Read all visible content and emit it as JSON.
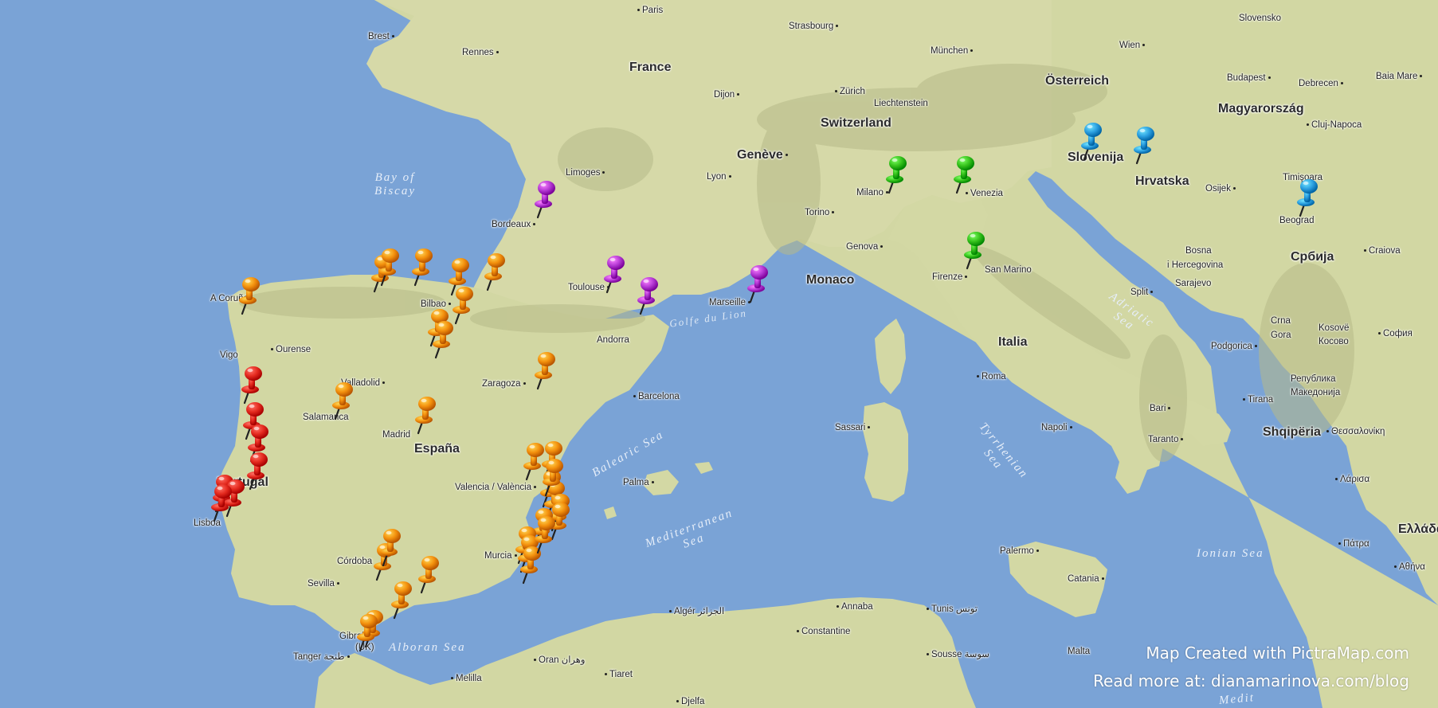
{
  "colors": {
    "sea": "#7aa3d6",
    "land": "#cfd6a3",
    "mountain": "#b4b889",
    "pin_portugal": "#e42a1f",
    "pin_spain": "#f3900d",
    "pin_france": "#b53ad4",
    "pin_italy": "#36c21c",
    "pin_balkans": "#2b9fe0"
  },
  "labels": [
    {
      "text": "Paris",
      "cls": "city dot"
    },
    {
      "text": "Brest",
      "cls": "city dotr"
    },
    {
      "text": "Rennes",
      "cls": "city dotr"
    },
    {
      "text": "France",
      "cls": "country"
    },
    {
      "text": "Strasbourg",
      "cls": "city dotr"
    },
    {
      "text": "München",
      "cls": "city dotr"
    },
    {
      "text": "Wien",
      "cls": "city dotr"
    },
    {
      "text": "Slovensko",
      "cls": "city"
    },
    {
      "text": "Budapest",
      "cls": "city dotr"
    },
    {
      "text": "Debrecen",
      "cls": "city dotr"
    },
    {
      "text": "Baia Mare",
      "cls": "city dotr"
    },
    {
      "text": "Österreich",
      "cls": "country"
    },
    {
      "text": "Magyarország",
      "cls": "country"
    },
    {
      "text": "Dijon",
      "cls": "city dotr"
    },
    {
      "text": "Zürich",
      "cls": "city dot"
    },
    {
      "text": "Liechtenstein",
      "cls": "city"
    },
    {
      "text": "Switzerland",
      "cls": "country"
    },
    {
      "text": "Cluj-Napoca",
      "cls": "city dot"
    },
    {
      "text": "Genève",
      "cls": "country dotr"
    },
    {
      "text": "Limoges",
      "cls": "city dotr"
    },
    {
      "text": "Lyon",
      "cls": "city dotr"
    },
    {
      "text": "Slovenija",
      "cls": "country"
    },
    {
      "text": "Hrvatska",
      "cls": "country"
    },
    {
      "text": "Osijek",
      "cls": "city dotr"
    },
    {
      "text": "Timişoara",
      "cls": "city"
    },
    {
      "text": "Milano",
      "cls": "city dotr"
    },
    {
      "text": "Venezia",
      "cls": "city dot"
    },
    {
      "text": "Bordeaux",
      "cls": "city dotr"
    },
    {
      "text": "Torino",
      "cls": "city dotr"
    },
    {
      "text": "Beograd",
      "cls": "city"
    },
    {
      "text": "Genova",
      "cls": "city dotr"
    },
    {
      "text": "Bosna",
      "cls": "city"
    },
    {
      "text": "i Hercegovina",
      "cls": "city"
    },
    {
      "text": "Sarajevo",
      "cls": "city"
    },
    {
      "text": "Craiova",
      "cls": "city dot"
    },
    {
      "text": "Србија",
      "cls": "country"
    },
    {
      "text": "Toulouse",
      "cls": "city dotr"
    },
    {
      "text": "Monaco",
      "cls": "country"
    },
    {
      "text": "Marseille",
      "cls": "city dotr"
    },
    {
      "text": "Firenze",
      "cls": "city dotr"
    },
    {
      "text": "San Marino",
      "cls": "city"
    },
    {
      "text": "A Coruña",
      "cls": "city"
    },
    {
      "text": "Bilbao",
      "cls": "city dotr"
    },
    {
      "text": "Split",
      "cls": "city dotr"
    },
    {
      "text": "Crna",
      "cls": "city"
    },
    {
      "text": "Gora",
      "cls": "city"
    },
    {
      "text": "Podgorica",
      "cls": "city dotr"
    },
    {
      "text": "Kosovë",
      "cls": "city"
    },
    {
      "text": "Косово",
      "cls": "city"
    },
    {
      "text": "София",
      "cls": "city dot"
    },
    {
      "text": "Ourense",
      "cls": "city dot"
    },
    {
      "text": "Andorra",
      "cls": "city"
    },
    {
      "text": "Italia",
      "cls": "country"
    },
    {
      "text": "Vigo",
      "cls": "city"
    },
    {
      "text": "Valladolid",
      "cls": "city dotr"
    },
    {
      "text": "Zaragoza",
      "cls": "city dotr"
    },
    {
      "text": "Roma",
      "cls": "city dot"
    },
    {
      "text": "Република",
      "cls": "city"
    },
    {
      "text": "Македонија",
      "cls": "city"
    },
    {
      "text": "Barcelona",
      "cls": "city dot"
    },
    {
      "text": "Tirana",
      "cls": "city dot"
    },
    {
      "text": "Salamanca",
      "cls": "city"
    },
    {
      "text": "Sassari",
      "cls": "city dotr"
    },
    {
      "text": "Bari",
      "cls": "city dotr"
    },
    {
      "text": "Madrid",
      "cls": "city"
    },
    {
      "text": "España",
      "cls": "country"
    },
    {
      "text": "Napoli",
      "cls": "city dotr"
    },
    {
      "text": "Shqipëria",
      "cls": "country"
    },
    {
      "text": "Θεσσαλονίκη",
      "cls": "city dot"
    },
    {
      "text": "Taranto",
      "cls": "city dotr"
    },
    {
      "text": "Portugal",
      "cls": "country"
    },
    {
      "text": "Valencia / València",
      "cls": "city dotr"
    },
    {
      "text": "Palma",
      "cls": "city dotr"
    },
    {
      "text": "Λάρισα",
      "cls": "city dot"
    },
    {
      "text": "Lisboa",
      "cls": "city"
    },
    {
      "text": "Ελλάδα",
      "cls": "country"
    },
    {
      "text": "Murcia",
      "cls": "city dotr"
    },
    {
      "text": "Πάτρα",
      "cls": "city dot"
    },
    {
      "text": "Córdoba",
      "cls": "city"
    },
    {
      "text": "Palermo",
      "cls": "city dotr"
    },
    {
      "text": "Αθήνα",
      "cls": "city dot"
    },
    {
      "text": "Catania",
      "cls": "city dotr"
    },
    {
      "text": "Sevilla",
      "cls": "city dotr"
    },
    {
      "text": "Algér الجزائر",
      "cls": "city dot"
    },
    {
      "text": "Annaba",
      "cls": "city dot"
    },
    {
      "text": "Tunis تونس",
      "cls": "city dot"
    },
    {
      "text": "Gibraltar",
      "cls": "city"
    },
    {
      "text": "(UK)",
      "cls": "city"
    },
    {
      "text": "Constantine",
      "cls": "city dot"
    },
    {
      "text": "Malta",
      "cls": "city"
    },
    {
      "text": "Tanger طنجة",
      "cls": "city dotr"
    },
    {
      "text": "Oran وهران",
      "cls": "city dot"
    },
    {
      "text": "Sousse سوسة",
      "cls": "city dot"
    },
    {
      "text": "Melilla",
      "cls": "city dot"
    },
    {
      "text": "Tiaret",
      "cls": "city dot"
    },
    {
      "text": "Djelfa",
      "cls": "city dot"
    }
  ],
  "seas": [
    {
      "text": "Bay of\nBiscay"
    },
    {
      "text": "Golfe du Lion"
    },
    {
      "text": "Adriatic\nSea"
    },
    {
      "text": "Balearic Sea"
    },
    {
      "text": "Tyrrhenian\nSea"
    },
    {
      "text": "Mediterranean\nSea"
    },
    {
      "text": "Ionian Sea"
    },
    {
      "text": "Alboran Sea"
    },
    {
      "text": "Medit"
    }
  ],
  "pins": [
    {
      "group": "portugal"
    },
    {
      "group": "portugal"
    },
    {
      "group": "portugal"
    },
    {
      "group": "portugal"
    },
    {
      "group": "portugal"
    },
    {
      "group": "portugal"
    },
    {
      "group": "portugal"
    },
    {
      "group": "spain"
    },
    {
      "group": "spain"
    },
    {
      "group": "spain"
    },
    {
      "group": "spain"
    },
    {
      "group": "spain"
    },
    {
      "group": "spain"
    },
    {
      "group": "spain"
    },
    {
      "group": "spain"
    },
    {
      "group": "spain"
    },
    {
      "group": "spain"
    },
    {
      "group": "spain"
    },
    {
      "group": "spain"
    },
    {
      "group": "spain"
    },
    {
      "group": "spain"
    },
    {
      "group": "spain"
    },
    {
      "group": "spain"
    },
    {
      "group": "spain"
    },
    {
      "group": "spain"
    },
    {
      "group": "spain"
    },
    {
      "group": "spain"
    },
    {
      "group": "spain"
    },
    {
      "group": "spain"
    },
    {
      "group": "spain"
    },
    {
      "group": "spain"
    },
    {
      "group": "spain"
    },
    {
      "group": "spain"
    },
    {
      "group": "spain"
    },
    {
      "group": "spain"
    },
    {
      "group": "spain"
    },
    {
      "group": "spain"
    },
    {
      "group": "france"
    },
    {
      "group": "france"
    },
    {
      "group": "france"
    },
    {
      "group": "france"
    },
    {
      "group": "italy"
    },
    {
      "group": "italy"
    },
    {
      "group": "italy"
    },
    {
      "group": "balkans"
    },
    {
      "group": "balkans"
    },
    {
      "group": "balkans"
    }
  ],
  "credit": {
    "line1": "Map Created with PictraMap.com",
    "line2": "Read more at: dianamarinova.com/blog"
  }
}
